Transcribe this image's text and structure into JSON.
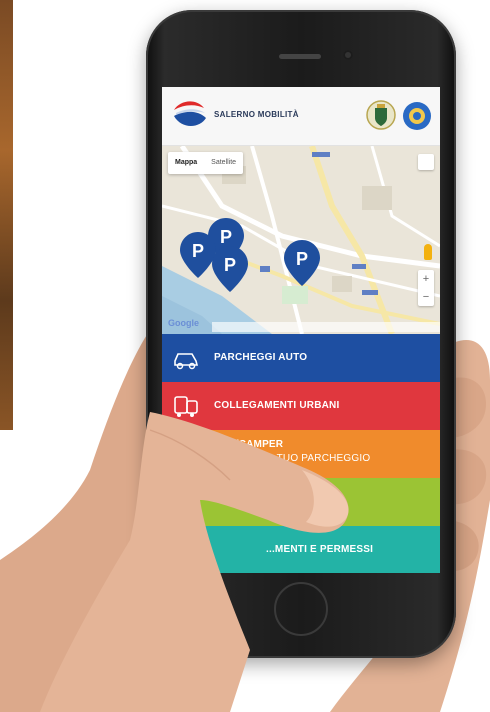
{
  "app": {
    "title": "SALERNO MOBILITÀ"
  },
  "map": {
    "type_control": [
      "Mappa",
      "Satellite"
    ],
    "active_type": "Mappa",
    "zoom_in": "+",
    "zoom_out": "−",
    "provider": "Google",
    "pin_label": "P",
    "pin_count": 4
  },
  "menu": [
    {
      "line1": "PARCHEGGI AUTO",
      "line2": "",
      "icon": "car-icon",
      "color": "#1e4fa2"
    },
    {
      "line1": "COLLEGAMENTI URBANI",
      "line2": "",
      "icon": "bus-icon",
      "color": "#e0373e"
    },
    {
      "line1": "BUS/CAMPER",
      "line2": "PRENOTA IL TUO PARCHEGGIO",
      "icon": "camper-icon",
      "color": "#f08b2c"
    },
    {
      "line1": "",
      "line2": "",
      "icon": "ev-charging-icon",
      "color": "#9bc434"
    },
    {
      "line1": "...MENTI E PERMESSI",
      "line2": "",
      "icon": "ticket-icon",
      "color": "#23b3a6"
    }
  ],
  "colors": {
    "pin": "#1f4f9e",
    "header_bg": "#f7f7f7",
    "skin": "#e7b79a"
  }
}
